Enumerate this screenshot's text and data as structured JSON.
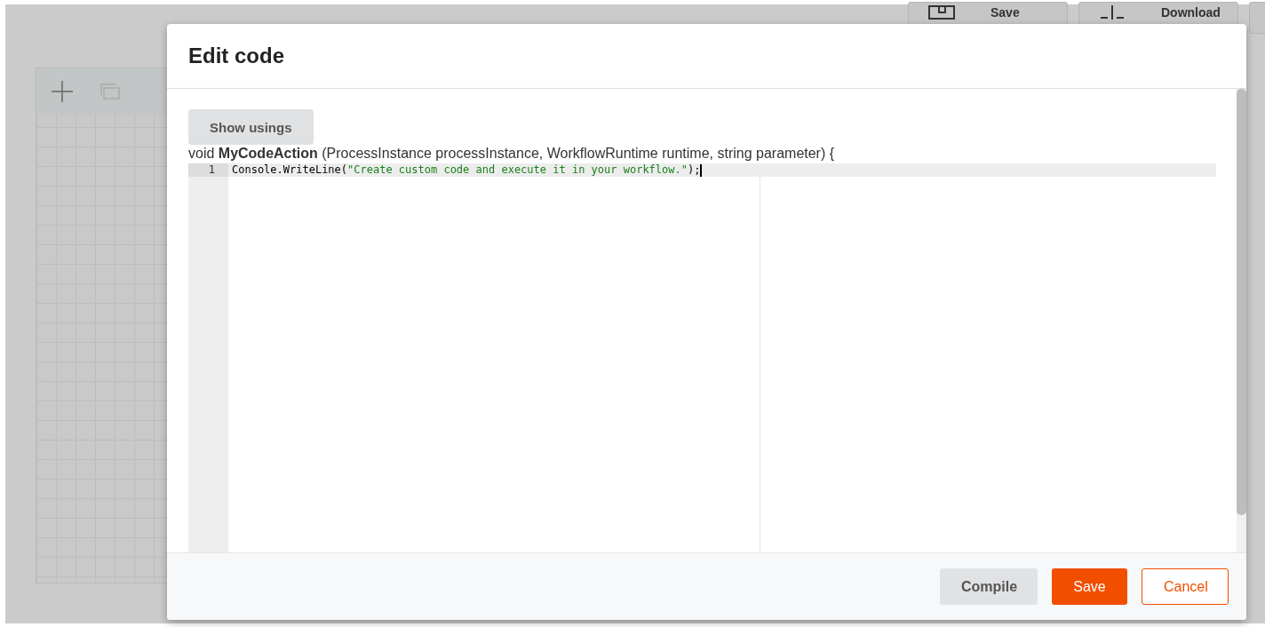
{
  "background": {
    "toolbar_buttons": [
      {
        "label": "Save",
        "kind": "save"
      },
      {
        "label": "Download",
        "kind": "download"
      }
    ]
  },
  "dialog": {
    "title": "Edit code",
    "show_usings_button": "Show usings",
    "signature": "void **MyCodeAction** (ProcessInstance processInstance, WorkflowRuntime runtime, string parameter) {",
    "editor": {
      "lines": [
        {
          "number": "1",
          "code": "Console.WriteLine(",
          "string": "\"Create custom code and execute it in your workflow.\"",
          "code_end": ");",
          "active": true
        }
      ]
    },
    "footer_buttons": [
      {
        "label": "Compile",
        "kind": "secondary"
      },
      {
        "label": "Save",
        "kind": "primary"
      },
      {
        "label": "Cancel",
        "kind": "outline"
      }
    ]
  }
}
